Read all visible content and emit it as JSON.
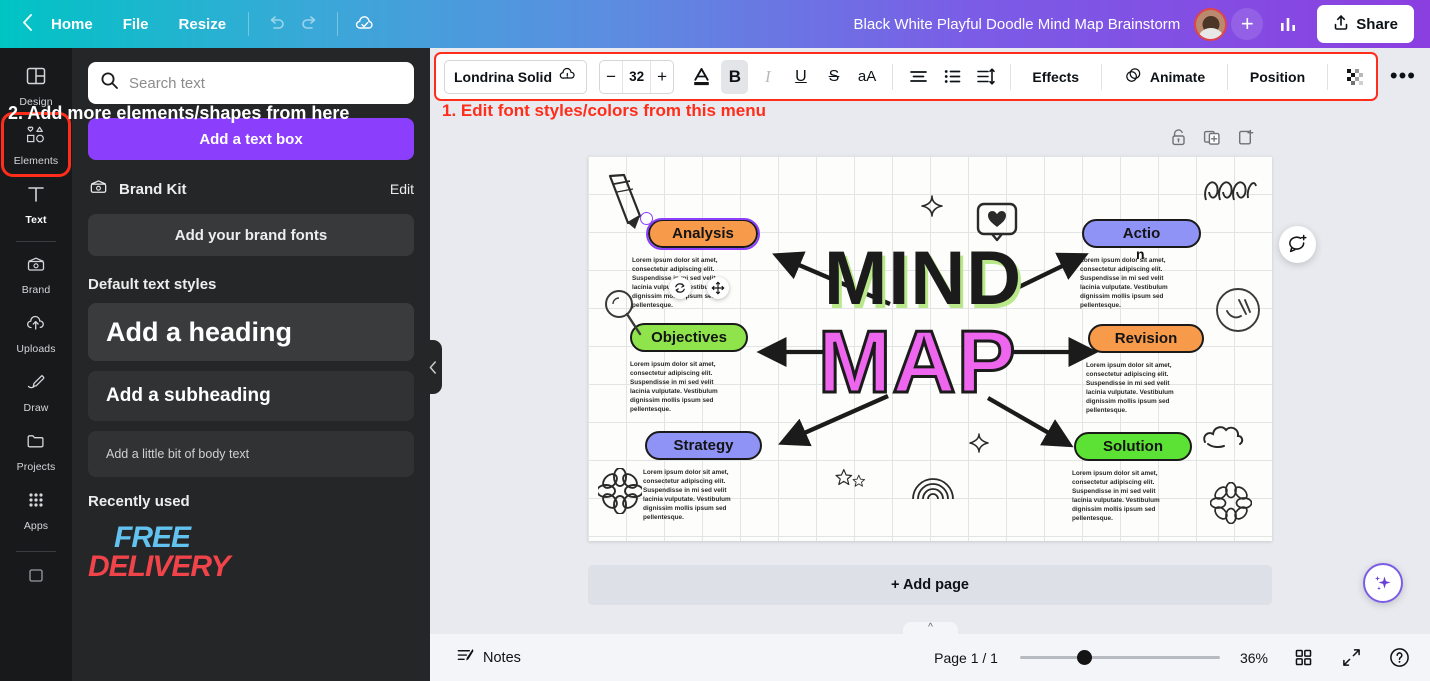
{
  "topbar": {
    "back_icon": "chevron-left-icon",
    "home": "Home",
    "file": "File",
    "resize": "Resize",
    "undo_icon": "undo-icon",
    "redo_icon": "redo-icon",
    "cloud_saved_icon": "cloud-check-icon",
    "title": "Black White Playful Doodle Mind Map Brainstorm",
    "add_collaborator": "+",
    "insights_icon": "bar-chart-icon",
    "share": "Share",
    "share_icon": "share-upload-icon"
  },
  "rail": {
    "items": [
      {
        "label": "Design",
        "icon": "design-layout-icon",
        "highlighted": false
      },
      {
        "label": "Elements",
        "icon": "shapes-icon",
        "highlighted": true
      },
      {
        "label": "Text",
        "icon": "text-t-icon",
        "highlighted": false
      },
      {
        "label": "Brand",
        "icon": "brand-wallet-icon",
        "highlighted": false
      },
      {
        "label": "Uploads",
        "icon": "upload-cloud-icon",
        "highlighted": false
      },
      {
        "label": "Draw",
        "icon": "pen-draw-icon",
        "highlighted": false
      },
      {
        "label": "Projects",
        "icon": "folder-icon",
        "highlighted": false
      },
      {
        "label": "Apps",
        "icon": "grid-apps-icon",
        "highlighted": false
      }
    ]
  },
  "panel": {
    "search_placeholder": "Search text",
    "search_value": "",
    "search_icon": "search-icon",
    "add_text_box": "Add a text box",
    "brand_kit_label": "Brand Kit",
    "brand_kit_icon": "brand-wallet-icon",
    "brand_kit_edit": "Edit",
    "add_brand_fonts": "Add your brand fonts",
    "default_styles_title": "Default text styles",
    "style_heading": "Add a heading",
    "style_subheading": "Add a subheading",
    "style_body": "Add a little bit of body text",
    "recently_used_title": "Recently used",
    "recent_thumb_line1": "FREE",
    "recent_thumb_line2": "DELIVERY",
    "recent_thumb_color1": "#63c3f0",
    "recent_thumb_color2": "#f0444a",
    "collapse_icon": "chevron-left-icon"
  },
  "toolbar": {
    "font_name": "Londrina Solid",
    "font_warning_icon": "cloud-alert-icon",
    "size_decrease": "−",
    "font_size": "32",
    "size_increase": "+",
    "text_color_icon": "text-color-A-icon",
    "bold": "B",
    "italic": "I",
    "underline": "U",
    "strikethrough": "S",
    "case": "aA",
    "align_icon": "align-center-icon",
    "list_icon": "bullet-list-icon",
    "spacing_icon": "line-spacing-icon",
    "effects": "Effects",
    "animate": "Animate",
    "animate_icon": "animate-circle-icon",
    "position": "Position",
    "transparency_icon": "transparency-checker-icon",
    "more_icon": "more-dots-icon",
    "accent_color": "#ff2d1a"
  },
  "annotations": {
    "red_note": "1. Edit font styles/colors from this menu",
    "white_note": "2. Add more elements/shapes from here",
    "red_color": "#ff2d1a"
  },
  "page_tools": {
    "lock_icon": "lock-icon",
    "duplicate_icon": "duplicate-page-icon",
    "add_page_icon": "add-page-icon"
  },
  "canvas": {
    "center_title_line1": "MIND",
    "center_title_line2": "MAP",
    "center_line1_shadow": "#b9e88a",
    "center_line2_fill": "#ee66ee",
    "body_text": "Lorem ipsum dolor sit amet, consectetur adipiscing elit. Suspendisse in mi sed velit lacinia vulputate. Vestibulum dignissim mollis ipsum sed pellentesque.",
    "nodes": [
      {
        "label": "Analysis",
        "color": "#f79a4a",
        "selected": true
      },
      {
        "label": "Objectives",
        "color": "#8fe34b",
        "selected": false
      },
      {
        "label": "Strategy",
        "color": "#8f93f5",
        "selected": false
      },
      {
        "label": "Actio",
        "color": "#8f93f5",
        "selected": false,
        "overflow": "n"
      },
      {
        "label": "Revision",
        "color": "#f79a4a",
        "selected": false
      },
      {
        "label": "Solution",
        "color": "#5ce234",
        "selected": false
      }
    ],
    "rotate_icon": "rotate-handle-icon",
    "move_icon": "move-handle-icon"
  },
  "add_page": "+ Add page",
  "bottombar": {
    "notes": "Notes",
    "notes_icon": "notes-icon",
    "page_info": "Page 1 / 1",
    "zoom_value": "36%",
    "grid_view_icon": "grid-view-icon",
    "fullscreen_icon": "fullscreen-icon",
    "help_icon": "help-circle-icon"
  },
  "floating": {
    "comment_icon": "comment-add-icon",
    "magic_icon": "magic-sparkle-icon"
  }
}
